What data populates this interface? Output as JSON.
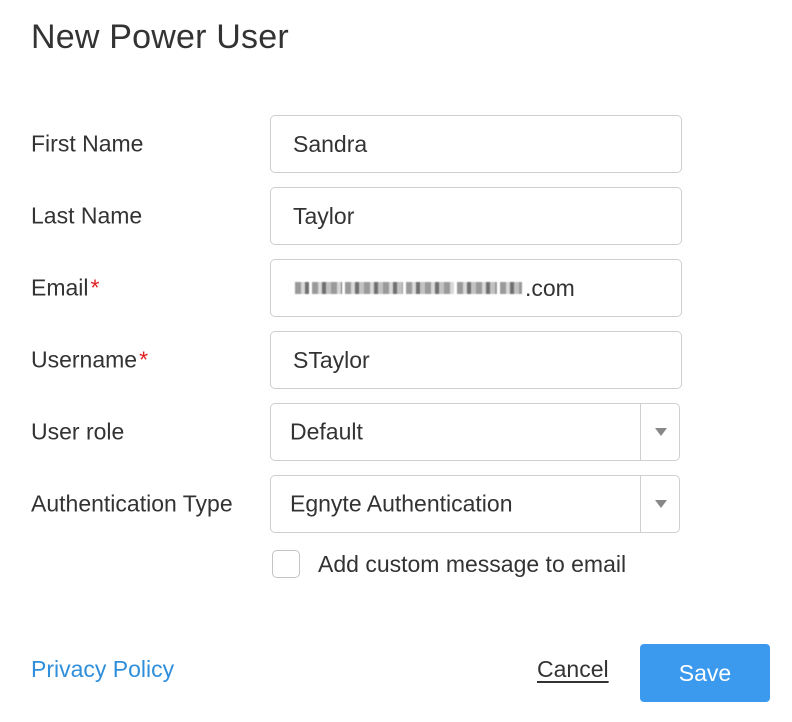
{
  "dialog": {
    "title": "New Power User"
  },
  "form": {
    "first_name": {
      "label": "First Name",
      "value": "Sandra"
    },
    "last_name": {
      "label": "Last Name",
      "value": "Taylor"
    },
    "email": {
      "label": "Email",
      "required_marker": "*",
      "value_suffix": ".com",
      "value_redacted": true
    },
    "username": {
      "label": "Username",
      "required_marker": "*",
      "value": "STaylor"
    },
    "user_role": {
      "label": "User role",
      "selected": "Default"
    },
    "authentication_type": {
      "label": "Authentication Type",
      "selected": "Egnyte Authentication"
    },
    "custom_message": {
      "label": "Add custom message to email",
      "checked": false
    }
  },
  "footer": {
    "privacy_link": "Privacy Policy",
    "cancel_label": "Cancel",
    "save_label": "Save"
  },
  "colors": {
    "accent": "#3b99ee",
    "link": "#2f8fdc",
    "required": "#e02020",
    "border": "#cfcfcf",
    "text": "#333333"
  }
}
